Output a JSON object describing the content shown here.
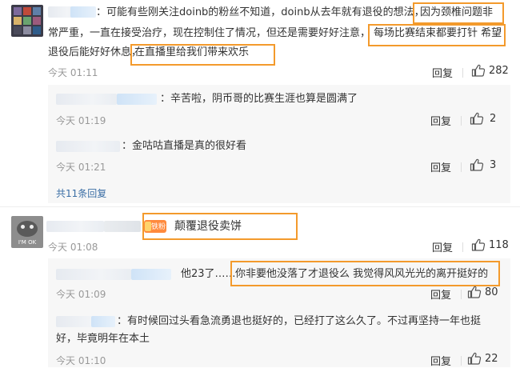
{
  "comments": [
    {
      "text_line1": "：可能有些刚关注doinb的粉丝不知道，doinb从去年就有退役的想法，",
      "hl1": "因为颈椎问题非",
      "text_line2": "常严重，一直在接受治疗，现在控制住了情况，但还是需要好好注意，",
      "hl2": "每场比赛结束都要打针 希望",
      "text_line3": "退役后能好好休息，",
      "hl3": "在直播里给我们带来欢乐",
      "time": "今天 01:11",
      "reply_label": "回复",
      "likes": "282"
    },
    {
      "text": "颠覆退役卖饼",
      "badge": "铁粉",
      "time": "今天 01:08",
      "reply_label": "回复",
      "likes": "118"
    }
  ],
  "replies_a": [
    {
      "text": "：辛苦啦，阴币哥的比赛生涯也算是圆满了",
      "time": "今天 01:19",
      "reply_label": "回复",
      "likes": "2"
    },
    {
      "text": "：金咕咕直播是真的很好看",
      "time": "今天 01:21",
      "reply_label": "回复",
      "likes": "3"
    }
  ],
  "more_replies": "共11条回复",
  "replies_b": [
    {
      "prefix": "他23了……",
      "hl": "你非要他没落了才退役么 我觉得风风光光的离开挺好的",
      "time": "今天 01:09",
      "reply_label": "回复",
      "likes": "80"
    },
    {
      "text_line1": "：有时候回过头看急流勇退也挺好的，已经打了这么久了。不过再坚持一年也挺",
      "text_line2": "好，毕竟明年在本土",
      "time": "今天 01:10",
      "reply_label": "回复",
      "likes": "22"
    }
  ],
  "avatar2_label": "I'M OK"
}
